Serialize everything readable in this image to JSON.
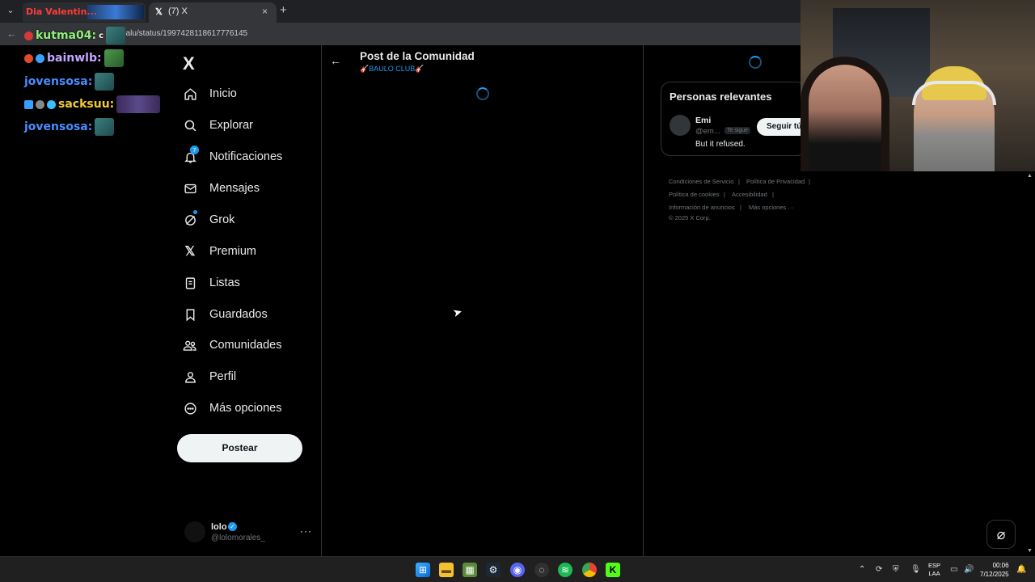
{
  "browser": {
    "tab1": {
      "title": "Dia Valentin..."
    },
    "tab2": {
      "icon": "x-logo-icon",
      "title": "(7) X",
      "close": "×"
    },
    "new_tab": "+",
    "url": "zbalu/status/1997428118617776145"
  },
  "chat": [
    {
      "user": "kutma04:",
      "color": "#8ff07a",
      "partial": "c"
    },
    {
      "user": "bainwlb:",
      "color": "#c6a6ff"
    },
    {
      "user": "jovensosa:",
      "color": "#4a8cff"
    },
    {
      "user": "sacksuu:",
      "color": "#f0c93a"
    },
    {
      "user": "jovensosa:",
      "color": "#4a8cff"
    }
  ],
  "sidebar": {
    "logo": "X",
    "items": [
      {
        "label": "Inicio",
        "icon": "home-icon"
      },
      {
        "label": "Explorar",
        "icon": "search-icon"
      },
      {
        "label": "Notificaciones",
        "icon": "bell-icon",
        "badge": "7"
      },
      {
        "label": "Mensajes",
        "icon": "mail-icon"
      },
      {
        "label": "Grok",
        "icon": "grok-icon"
      },
      {
        "label": "Premium",
        "icon": "x-logo-icon"
      },
      {
        "label": "Listas",
        "icon": "list-icon"
      },
      {
        "label": "Guardados",
        "icon": "bookmark-icon"
      },
      {
        "label": "Comunidades",
        "icon": "communities-icon"
      },
      {
        "label": "Perfil",
        "icon": "person-icon"
      },
      {
        "label": "Más opciones",
        "icon": "more-circle-icon"
      }
    ],
    "post_button": "Postear",
    "profile": {
      "name": "lolo",
      "handle": "@lolomorales_",
      "more": "···"
    }
  },
  "main": {
    "title": "Post de la Comunidad",
    "subtitle": "🎸BAULO CLUB🎸"
  },
  "right": {
    "relevant": {
      "title": "Personas relevantes",
      "name": "Emi",
      "handle": "@em...",
      "follows_you": "Te sigue",
      "follow_button": "Seguir tú",
      "bio": "But it refused."
    },
    "footer": {
      "terms": "Condiciones de Servicio",
      "privacy": "Política de Privacidad",
      "cookies": "Política de cookies",
      "accessibility": "Accesibilidad",
      "ads": "Información de anuncios",
      "more": "Más opciones ···",
      "copyright": "© 2025 X Corp."
    }
  },
  "taskbar": {
    "lang_top": "ESP",
    "lang_bottom": "LAA",
    "time": "00:06",
    "date": "7/12/2025"
  },
  "colors": {
    "accent": "#1d9bf0",
    "background": "#000000",
    "border": "#2f3336"
  }
}
